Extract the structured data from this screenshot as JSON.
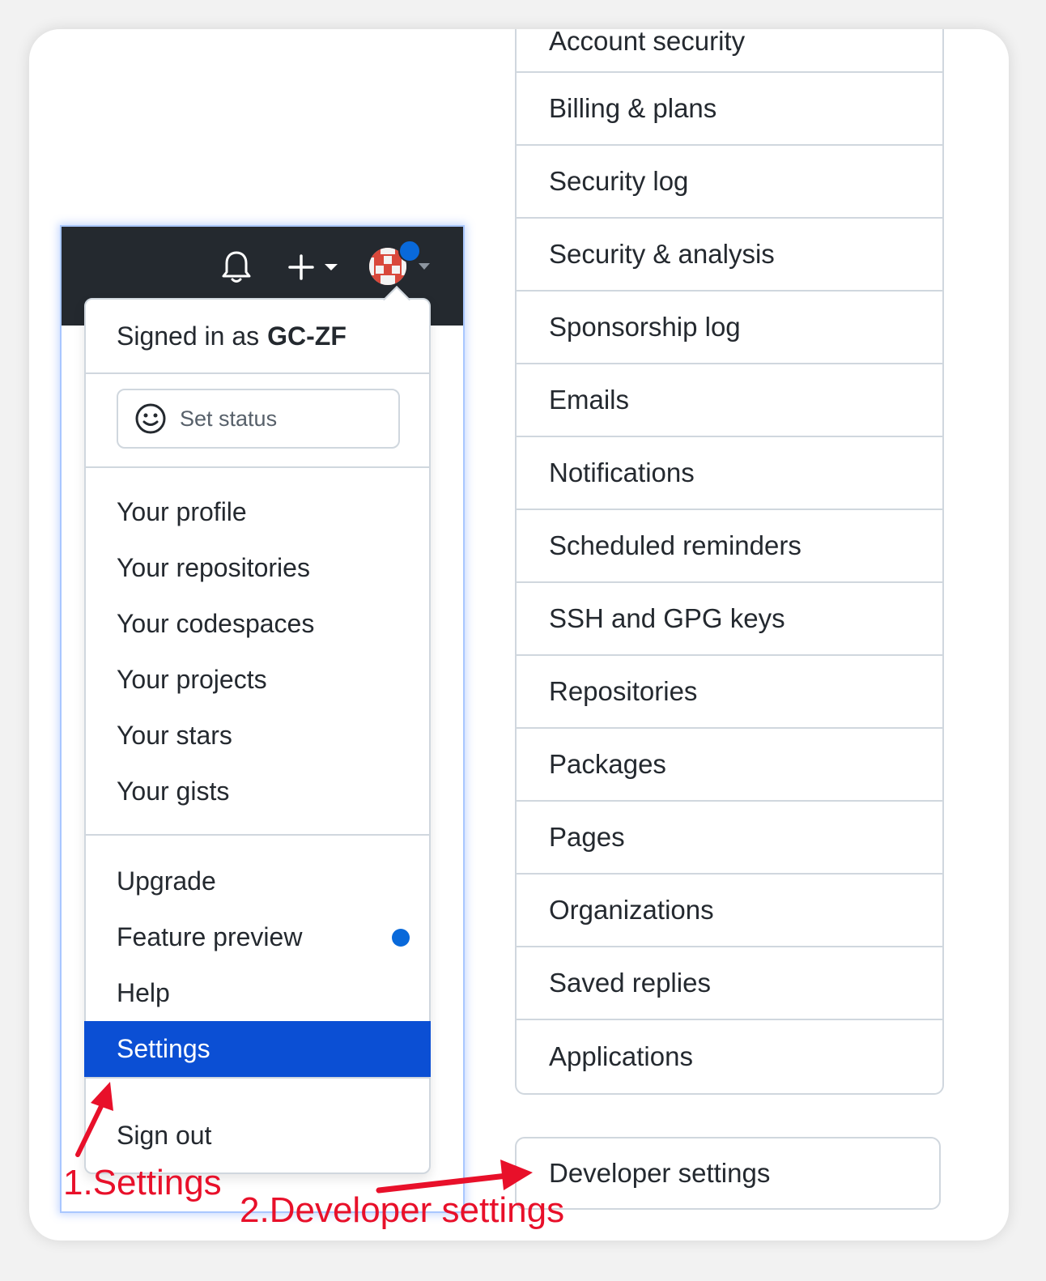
{
  "settings_nav": {
    "items": [
      {
        "label": "Account security"
      },
      {
        "label": "Billing & plans"
      },
      {
        "label": "Security log"
      },
      {
        "label": "Security & analysis"
      },
      {
        "label": "Sponsorship log"
      },
      {
        "label": "Emails"
      },
      {
        "label": "Notifications"
      },
      {
        "label": "Scheduled reminders"
      },
      {
        "label": "SSH and GPG keys"
      },
      {
        "label": "Repositories"
      },
      {
        "label": "Packages"
      },
      {
        "label": "Pages"
      },
      {
        "label": "Organizations"
      },
      {
        "label": "Saved replies"
      },
      {
        "label": "Applications"
      }
    ],
    "developer_settings": "Developer settings"
  },
  "header": {
    "icons": [
      "bell-icon",
      "plus-icon",
      "chevron-down-icon",
      "avatar",
      "chevron-down-icon"
    ]
  },
  "user_menu": {
    "signed_in_prefix": "Signed in as",
    "username": "GC-ZF",
    "set_status": "Set status",
    "group1": [
      "Your profile",
      "Your repositories",
      "Your codespaces",
      "Your projects",
      "Your stars",
      "Your gists"
    ],
    "group2": [
      "Upgrade",
      "Feature preview",
      "Help",
      "Settings"
    ],
    "sign_out": "Sign out",
    "active_item": "Settings"
  },
  "annotations": {
    "step1": "1.Settings",
    "step2": "2.Developer settings"
  },
  "colors": {
    "header_bg": "#24292f",
    "active_bg": "#0b4fd4",
    "accent_blue": "#0969da",
    "annotation_red": "#e8102a",
    "border": "#d0d7de"
  }
}
